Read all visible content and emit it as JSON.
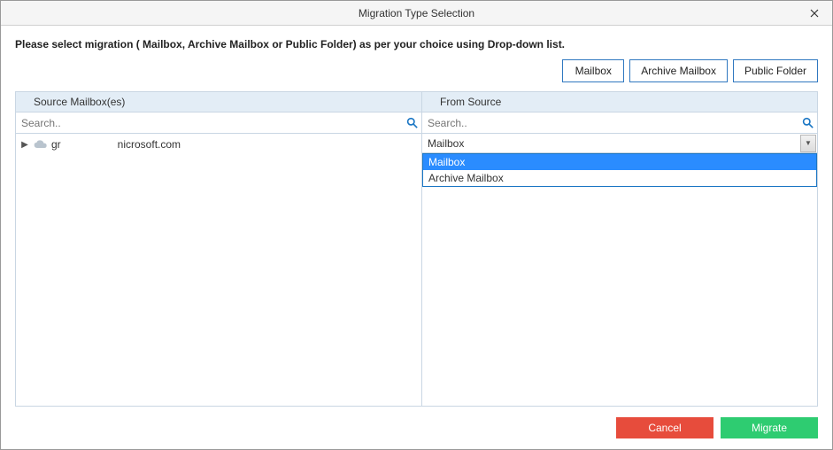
{
  "window": {
    "title": "Migration Type Selection"
  },
  "instruction": "Please select migration ( Mailbox, Archive Mailbox or Public Folder) as per your choice using Drop-down list.",
  "type_buttons": {
    "mailbox": "Mailbox",
    "archive": "Archive Mailbox",
    "public": "Public Folder"
  },
  "columns": {
    "left_header": "Source Mailbox(es)",
    "right_header": "From Source"
  },
  "search": {
    "placeholder": "Search.."
  },
  "source_tree": {
    "node_prefix": "gr",
    "node_suffix": "nicrosoft.com"
  },
  "dropdown": {
    "selected": "Mailbox",
    "options": [
      "Mailbox",
      "Archive Mailbox"
    ]
  },
  "actions": {
    "cancel": "Cancel",
    "migrate": "Migrate"
  }
}
